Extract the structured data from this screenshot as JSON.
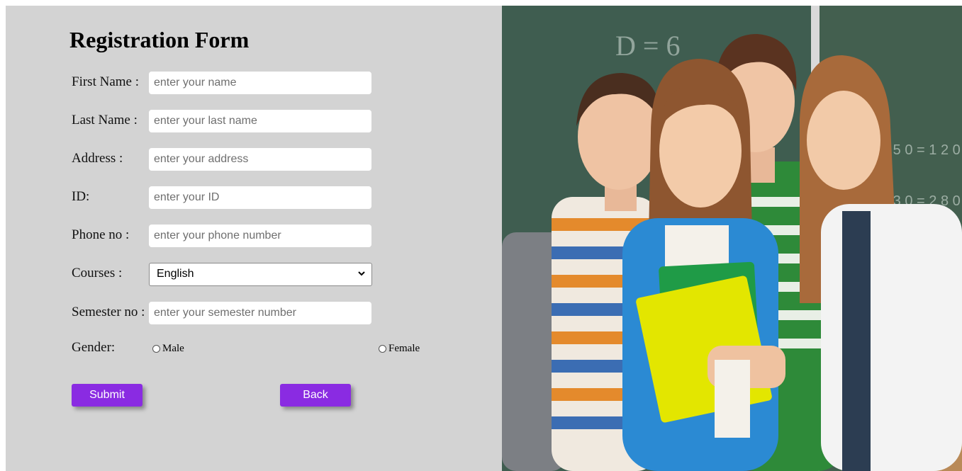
{
  "form": {
    "title": "Registration Form",
    "fields": {
      "first_name": {
        "label": "First Name :",
        "placeholder": "enter your name"
      },
      "last_name": {
        "label": "Last Name :",
        "placeholder": "enter your last name"
      },
      "address": {
        "label": "Address :",
        "placeholder": "enter your address"
      },
      "id": {
        "label": "ID:",
        "placeholder": "enter your ID"
      },
      "phone": {
        "label": "Phone no :",
        "placeholder": "enter your phone number"
      },
      "courses": {
        "label": "Courses :",
        "selected": "English"
      },
      "semester": {
        "label": "Semester no :",
        "placeholder": "enter your semester number"
      }
    },
    "gender": {
      "label": "Gender:",
      "options": [
        "Male",
        "Female"
      ]
    },
    "buttons": {
      "submit": "Submit",
      "back": "Back"
    }
  },
  "photo": {
    "chalkboard_text": [
      "D = 6",
      "1 5 0 = 1 2 0",
      "1 3 0 = 2 8 0"
    ]
  },
  "colors": {
    "form_background": "#d3d3d3",
    "button_accent": "#8a2be2",
    "input_background": "#ffffff"
  }
}
